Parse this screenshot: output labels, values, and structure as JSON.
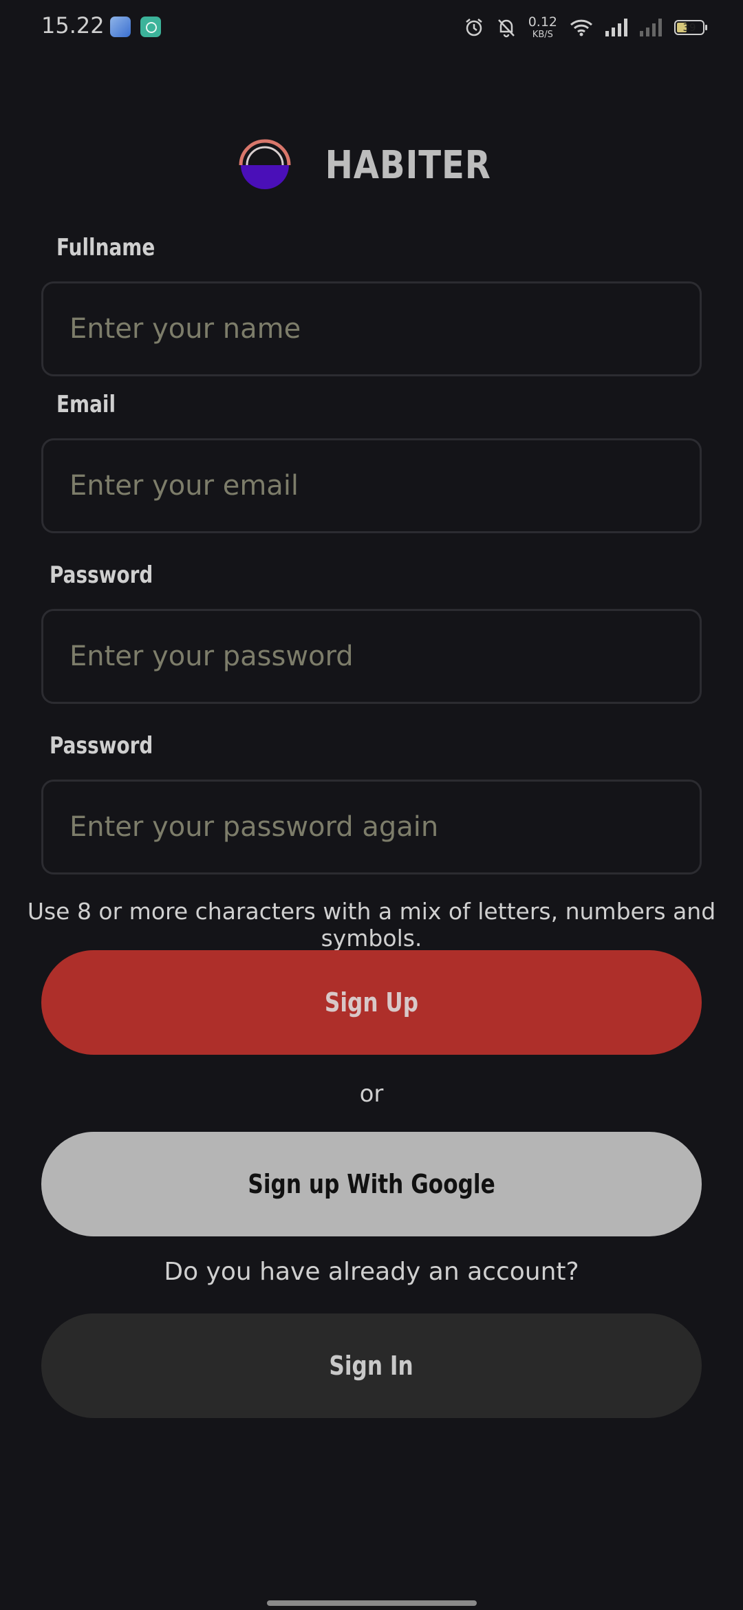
{
  "status_bar": {
    "time": "15.22",
    "net_speed_value": "0.12",
    "net_speed_unit": "KB/S",
    "battery_level": "39",
    "icons": [
      "app-icon-blue",
      "app-icon-green",
      "alarm-icon",
      "bell-off-icon",
      "wifi-icon",
      "signal-icon",
      "signal-icon-dim",
      "battery-icon"
    ]
  },
  "brand": {
    "name": "HABITER",
    "logo_colors": {
      "arc": "#d9776b",
      "fill": "#4a0fb8"
    }
  },
  "form": {
    "fullname": {
      "label": "Fullname",
      "placeholder": "Enter your name",
      "value": ""
    },
    "email": {
      "label": "Email",
      "placeholder": "Enter your email",
      "value": ""
    },
    "password": {
      "label": "Password",
      "placeholder": "Enter your password",
      "value": ""
    },
    "password_confirm": {
      "label": "Password",
      "placeholder": "Enter your password again",
      "value": ""
    },
    "hint": "Use 8 or more characters with a mix of letters, numbers and symbols."
  },
  "actions": {
    "signup_label": "Sign Up",
    "or_label": "or",
    "google_label": "Sign up With Google",
    "account_question": "Do you have already an account?",
    "signin_label": "Sign In"
  },
  "colors": {
    "background": "#141418",
    "signup_button": "#ae2f2a",
    "google_button": "#b5b5b5",
    "signin_button": "#292929",
    "placeholder": "#7d7d6a"
  }
}
